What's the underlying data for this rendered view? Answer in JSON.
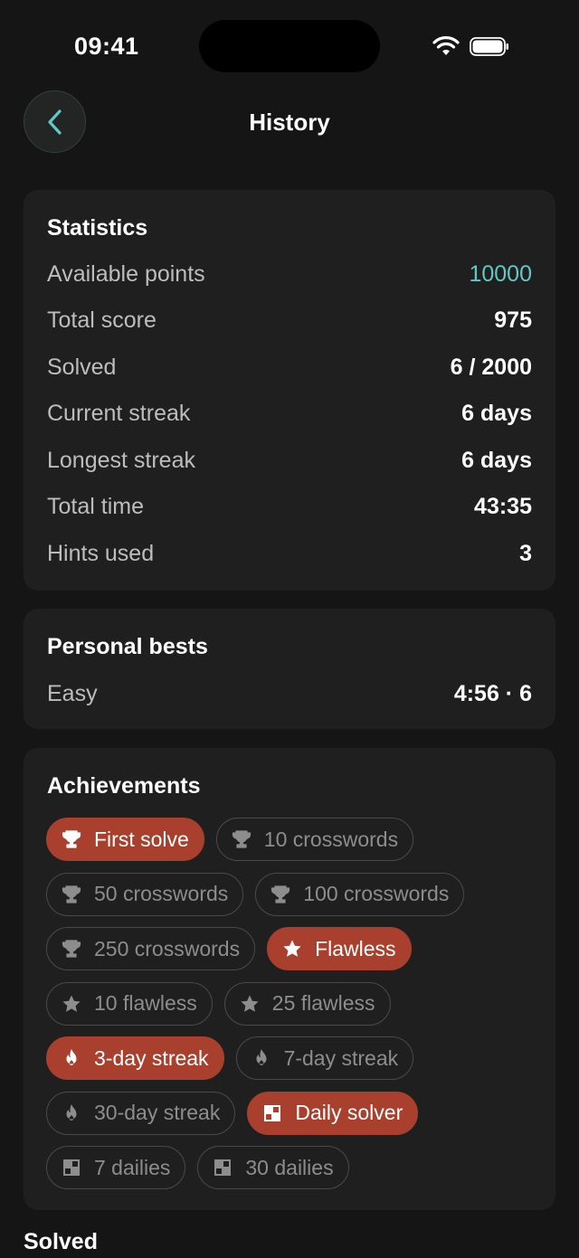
{
  "status_bar": {
    "time": "09:41"
  },
  "nav": {
    "title": "History"
  },
  "statistics": {
    "title": "Statistics",
    "rows": [
      {
        "label": "Available points",
        "value": "10000"
      },
      {
        "label": "Total score",
        "value": "975"
      },
      {
        "label": "Solved",
        "value": "6 / 2000"
      },
      {
        "label": "Current streak",
        "value": "6 days"
      },
      {
        "label": "Longest streak",
        "value": "6 days"
      },
      {
        "label": "Total time",
        "value": "43:35"
      },
      {
        "label": "Hints used",
        "value": "3"
      }
    ]
  },
  "personal_bests": {
    "title": "Personal bests",
    "rows": [
      {
        "label": "Easy",
        "value": "4:56 · 6"
      }
    ]
  },
  "achievements": {
    "title": "Achievements",
    "rows": [
      [
        {
          "label": "First solve",
          "icon": "trophy-icon",
          "earned": true
        },
        {
          "label": "10 crosswords",
          "icon": "trophy-icon",
          "earned": false
        }
      ],
      [
        {
          "label": "50 crosswords",
          "icon": "trophy-icon",
          "earned": false
        },
        {
          "label": "100 crosswords",
          "icon": "trophy-icon",
          "earned": false
        }
      ],
      [
        {
          "label": "250 crosswords",
          "icon": "trophy-icon",
          "earned": false
        },
        {
          "label": "Flawless",
          "icon": "star-icon",
          "earned": true
        }
      ],
      [
        {
          "label": "10 flawless",
          "icon": "star-icon",
          "earned": false
        },
        {
          "label": "25 flawless",
          "icon": "star-icon",
          "earned": false
        }
      ],
      [
        {
          "label": "3-day streak",
          "icon": "flame-icon",
          "earned": true
        },
        {
          "label": "7-day streak",
          "icon": "flame-icon",
          "earned": false
        }
      ],
      [
        {
          "label": "30-day streak",
          "icon": "flame-icon",
          "earned": false
        },
        {
          "label": "Daily solver",
          "icon": "grid-icon",
          "earned": true
        }
      ],
      [
        {
          "label": "7 dailies",
          "icon": "grid-icon",
          "earned": false
        },
        {
          "label": "30 dailies",
          "icon": "grid-icon",
          "earned": false
        }
      ]
    ]
  },
  "solved_section": {
    "title": "Solved"
  },
  "colors": {
    "background": "#151515",
    "card": "#1f1f1f",
    "accent": "#5fc9c3",
    "earned_chip": "#a8402d",
    "locked_chip_border": "#4a4a4a"
  }
}
